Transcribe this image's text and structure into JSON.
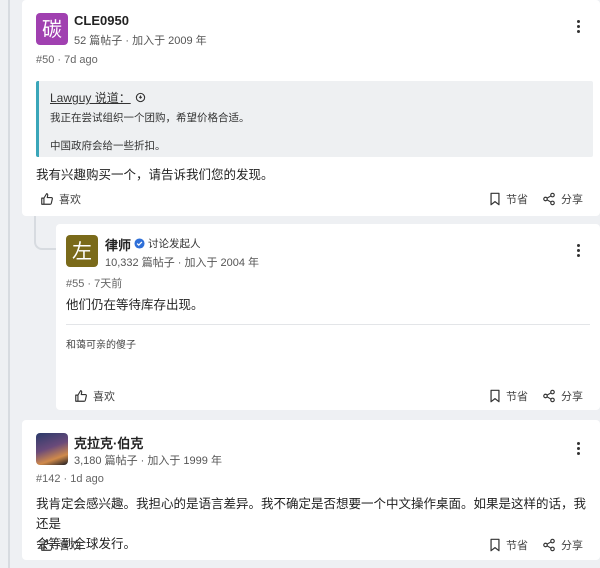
{
  "posts": [
    {
      "username": "CLE0950",
      "avatar_char": "碳",
      "avatar_color": "#a040b0",
      "user_stats": "52 篇帖子 · 加入于 2009 年",
      "post_meta": "#50 · 7d ago",
      "quote": {
        "author": "Lawguy 说道：",
        "lines": [
          "我正在尝试组织一个团购，希望价格合适。",
          "中国政府会给一些折扣。"
        ]
      },
      "body": "我有兴趣购买一个，请告诉我们您的发现。",
      "like_label": "喜欢",
      "bookmark_label": "节省",
      "share_label": "分享"
    },
    {
      "username": "律师",
      "avatar_char": "左",
      "avatar_color": "#7a6a1a",
      "op_badge": "讨论发起人",
      "user_stats": "10,332 篇帖子 · 加入于 2004 年",
      "post_meta": "#55 · 7天前",
      "body": "他们仍在等待库存出现。",
      "signature": "和蔼可亲的傻子",
      "like_label": "喜欢",
      "bookmark_label": "节省",
      "share_label": "分享"
    },
    {
      "username": "克拉克·伯克",
      "user_stats": "3,180 篇帖子 · 加入于 1999 年",
      "post_meta": "#142 · 1d ago",
      "body_lines": [
        "我肯定会感兴趣。我担心的是语言差异。我不确定是否想要一个中文操作桌面。如果是这样的话，我还是",
        "会等到全球发行。"
      ],
      "like_label": "喜欢",
      "bookmark_label": "节省",
      "share_label": "分享"
    }
  ],
  "colors": {
    "quote_border": "#3aa6b9",
    "verified": "#2e6fd8"
  }
}
